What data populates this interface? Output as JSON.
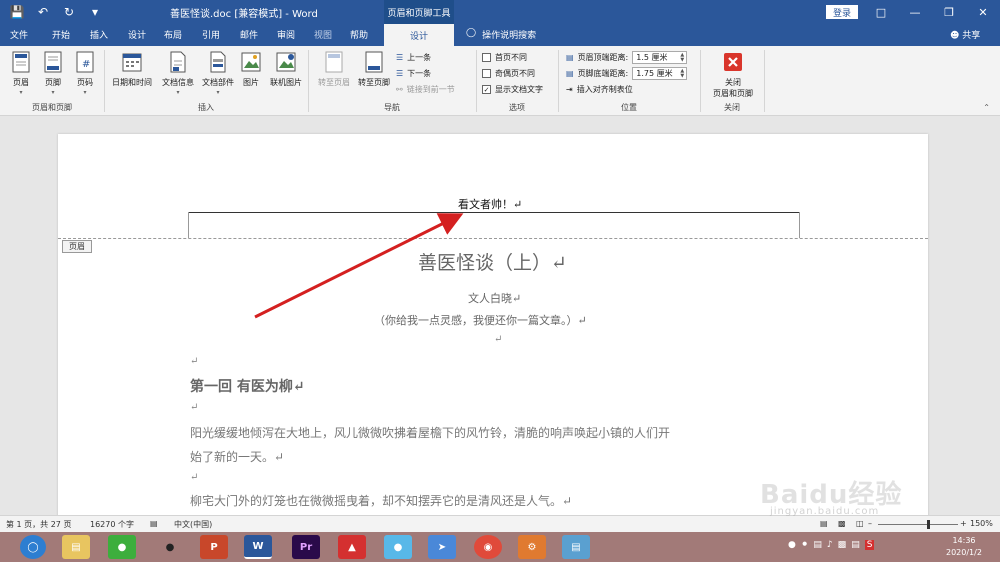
{
  "titlebar": {
    "document_title": "善医怪谈.doc [兼容模式] - Word",
    "context_tool": "页眉和页脚工具",
    "login": "登录"
  },
  "tabs": {
    "file": "文件",
    "home": "开始",
    "insert": "插入",
    "design_doc": "设计",
    "layout": "布局",
    "references": "引用",
    "mailings": "邮件",
    "review": "审阅",
    "view": "视图",
    "help": "帮助",
    "design": "设计",
    "tell_me": "操作说明搜索",
    "share": "共享"
  },
  "ribbon": {
    "header": "页眉",
    "footer": "页脚",
    "page_number": "页码",
    "group_header_footer": "页眉和页脚",
    "date_time": "日期和时间",
    "doc_info": "文档信息",
    "doc_parts": "文档部件",
    "picture": "图片",
    "online_picture": "联机图片",
    "group_insert": "插入",
    "goto_header": "转至页眉",
    "goto_footer": "转至页脚",
    "previous": "上一条",
    "next": "下一条",
    "link_previous": "链接到前一节",
    "group_navigation": "导航",
    "diff_first_page": "首页不同",
    "diff_odd_even": "奇偶页不同",
    "show_doc_text": "显示文档文字",
    "group_options": "选项",
    "header_top_label": "页眉顶端距离:",
    "header_top_value": "1.5 厘米",
    "footer_bottom_label": "页脚底端距离:",
    "footer_bottom_value": "1.75 厘米",
    "insert_align_tab": "插入对齐制表位",
    "group_position": "位置",
    "close_line1": "关闭",
    "close_line2": "页眉和页脚",
    "group_close": "关闭"
  },
  "document": {
    "header_text": "看文者帅！↵",
    "header_tag": "页眉",
    "title": "善医怪谈（上）↵",
    "author": "文人白晓↵",
    "subtitle": "（你给我一点灵感，我便还你一篇文章。）↵",
    "para_mark": "↵",
    "chapter": "第一回  有医为柳↵",
    "para1_line1": "阳光缓缓地倾泻在大地上，风儿微微吹拂着屋檐下的风竹铃，清脆的响声唤起小镇的人们开",
    "para1_line2": "始了新的一天。↵",
    "para2": "柳宅大门外的灯笼也在微微摇曳着，却不知摆弄它的是清风还是人气。↵"
  },
  "statusbar": {
    "page": "第 1 页，共 27 页",
    "words": "16270 个字",
    "language": "中文(中国)",
    "zoom": "150%"
  },
  "taskbar": {
    "word_label": "W",
    "powerpoint_label": "P",
    "premiere_label": "Pr",
    "sogou_label": "S",
    "time": "14:36",
    "date": "2020/1/2"
  },
  "watermark": {
    "brand": "Baidu经验",
    "url": "jingyan.baidu.com"
  },
  "colors": {
    "word_blue": "#2b579a",
    "annotation_red": "#d42020",
    "close_red": "#d9352b"
  }
}
